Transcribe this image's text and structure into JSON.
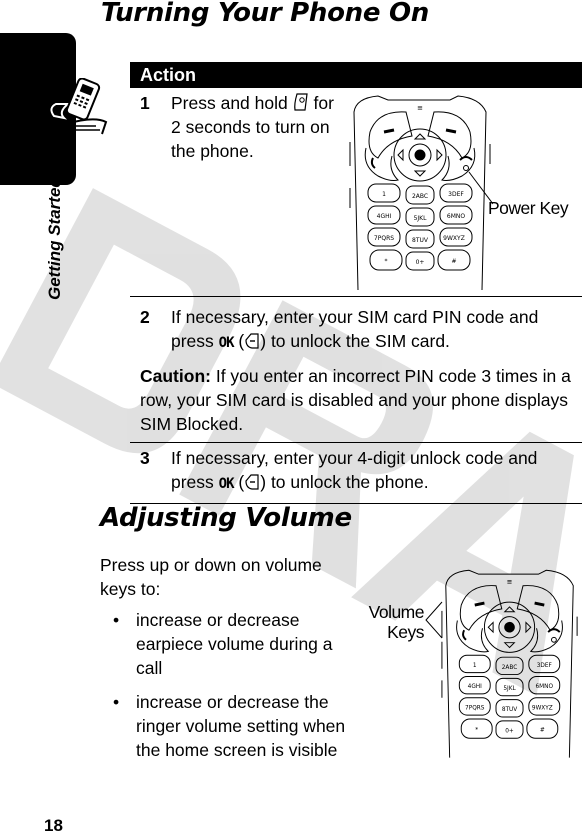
{
  "watermark": {
    "text": "DRAFT",
    "color": "#bdbdbd"
  },
  "sidebar": {
    "section_label": "Getting Started",
    "icon": "phone-with-motion-icon"
  },
  "section_1": {
    "title": "Turning Your Phone On",
    "table": {
      "header": "Action",
      "steps": [
        {
          "number": "1",
          "text_before": "Press and hold",
          "icon": "power-key-icon",
          "text_after": "for 2 seconds to turn on the phone."
        },
        {
          "number": "2",
          "text_before": "If necessary, enter your SIM card PIN code and press",
          "key_label": "OK",
          "icon": "left-soft-key-icon",
          "text_after": "to unlock the SIM card."
        },
        {
          "number": "3",
          "text_before": "If necessary, enter your 4-digit unlock code and press",
          "key_label": "OK",
          "icon": "left-soft-key-icon",
          "text_after": "to unlock the phone."
        }
      ],
      "caution": {
        "label": "Caution:",
        "text": "If you enter an incorrect PIN code 3 times in a row, your SIM card is disabled and your phone displays SIM Blocked."
      }
    },
    "illustration": {
      "callout": "Power Key",
      "keypad": [
        "1",
        "2ABC",
        "3DEF",
        "4GHI",
        "5JKL",
        "6MNO",
        "7PQRS",
        "8TUV",
        "9WXYZ",
        "*",
        "0+",
        "#"
      ]
    }
  },
  "section_2": {
    "title": "Adjusting Volume",
    "intro": "Press up or down on volume keys to:",
    "bullets": [
      "increase or decrease earpiece volume during a call",
      "increase or decrease the ringer volume setting when the home screen is visible"
    ],
    "illustration": {
      "callout_line_1": "Volume",
      "callout_line_2": "Keys"
    }
  },
  "footer": {
    "page_number": "18"
  }
}
